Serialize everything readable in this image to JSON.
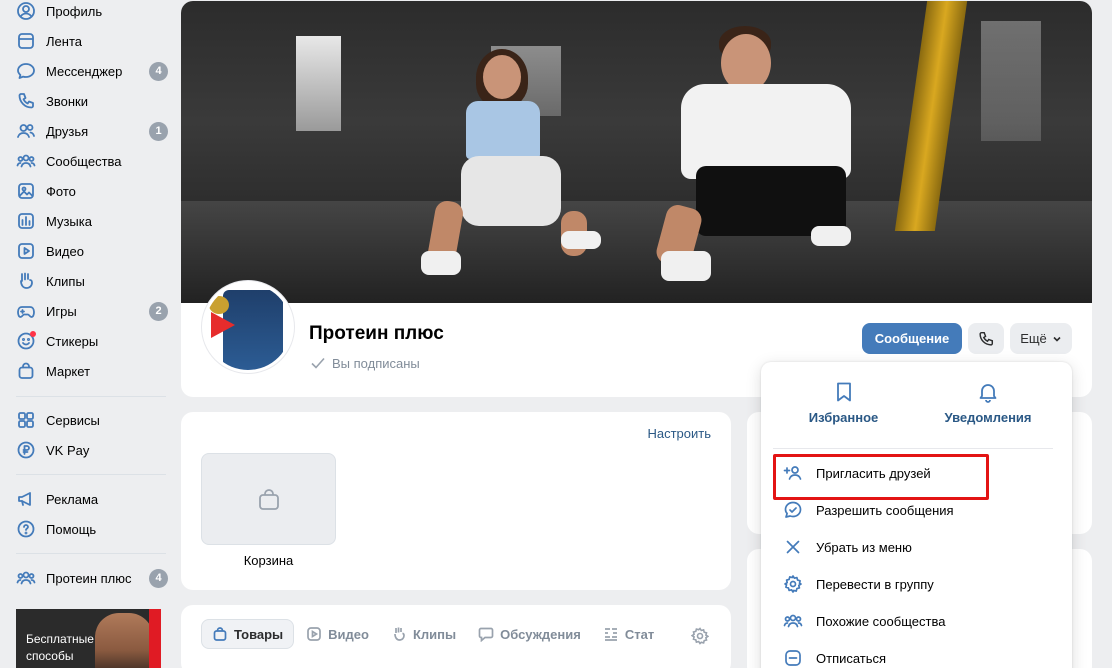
{
  "sidebar": {
    "items": [
      {
        "label": "Профиль",
        "icon": "user-circle-icon"
      },
      {
        "label": "Лента",
        "icon": "newsfeed-icon"
      },
      {
        "label": "Мессенджер",
        "icon": "message-icon",
        "badge": "4"
      },
      {
        "label": "Звонки",
        "icon": "phone-icon"
      },
      {
        "label": "Друзья",
        "icon": "friends-icon",
        "badge": "1"
      },
      {
        "label": "Сообщества",
        "icon": "communities-icon"
      },
      {
        "label": "Фото",
        "icon": "photo-icon"
      },
      {
        "label": "Музыка",
        "icon": "music-icon"
      },
      {
        "label": "Видео",
        "icon": "video-icon"
      },
      {
        "label": "Клипы",
        "icon": "clips-icon"
      },
      {
        "label": "Игры",
        "icon": "gamepad-icon",
        "badge": "2"
      },
      {
        "label": "Стикеры",
        "icon": "sticker-icon"
      },
      {
        "label": "Маркет",
        "icon": "market-bag-icon"
      }
    ],
    "items2": [
      {
        "label": "Сервисы",
        "icon": "services-icon"
      },
      {
        "label": "VK Pay",
        "icon": "vkpay-icon"
      }
    ],
    "items3": [
      {
        "label": "Реклама",
        "icon": "megaphone-icon"
      },
      {
        "label": "Помощь",
        "icon": "help-icon"
      }
    ],
    "group_item": {
      "label": "Протеин плюс",
      "icon": "communities-icon",
      "badge": "4"
    },
    "ad_text": "Бесплатные способы"
  },
  "group": {
    "title": "Протеин плюс",
    "subscribed": "Вы подписаны",
    "message_button": "Сообщение",
    "more_button": "Ещё"
  },
  "market": {
    "configure": "Настроить",
    "cart_label": "Корзина"
  },
  "tabs": [
    {
      "label": "Товары",
      "icon": "bag-icon",
      "active": true
    },
    {
      "label": "Видео",
      "icon": "video-play-icon"
    },
    {
      "label": "Клипы",
      "icon": "clips-icon"
    },
    {
      "label": "Обсуждения",
      "icon": "discussion-icon"
    },
    {
      "label": "Стат",
      "icon": "stats-icon"
    }
  ],
  "dropdown": {
    "favorites": "Избранное",
    "notifications": "Уведомления",
    "items": [
      {
        "label": "Пригласить друзей",
        "icon": "add-friend-icon"
      },
      {
        "label": "Разрешить сообщения",
        "icon": "allow-messages-icon"
      },
      {
        "label": "Убрать из меню",
        "icon": "cross-icon"
      },
      {
        "label": "Перевести в группу",
        "icon": "gear-icon"
      },
      {
        "label": "Похожие сообщества",
        "icon": "similar-communities-icon"
      },
      {
        "label": "Отписаться",
        "icon": "unsubscribe-icon"
      }
    ]
  },
  "colors": {
    "accent": "#447bba",
    "link": "#2a5885",
    "highlight": "#e31414",
    "background": "#edeef0"
  }
}
